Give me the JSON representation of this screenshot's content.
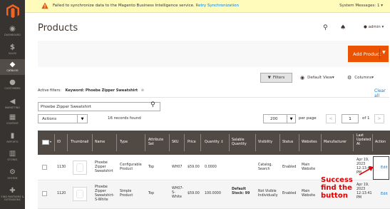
{
  "sidebar": {
    "items": [
      {
        "label": "DASHBOARD",
        "icon": "speedometer-icon"
      },
      {
        "label": "SALES",
        "icon": "dollar-icon"
      },
      {
        "label": "CATALOG",
        "icon": "cube-icon"
      },
      {
        "label": "CUSTOMERS",
        "icon": "person-icon"
      },
      {
        "label": "MARKETING",
        "icon": "megaphone-icon"
      },
      {
        "label": "CONTENT",
        "icon": "layout-icon"
      },
      {
        "label": "REPORTS",
        "icon": "bar-chart-icon"
      },
      {
        "label": "STORES",
        "icon": "store-icon"
      },
      {
        "label": "SYSTEM",
        "icon": "gear-icon"
      },
      {
        "label": "FIND PARTNERS & EXTENSIONS",
        "icon": "puzzle-icon"
      }
    ],
    "active": "CATALOG"
  },
  "banner": {
    "message": "Failed to synchronize data to the Magento Business Intelligence service.",
    "link": "Retry Synchronization",
    "system_messages": "System Messages: 1"
  },
  "header": {
    "title": "Products",
    "user": "admin"
  },
  "actions": {
    "add_product": "Add Product",
    "filters": "Filters",
    "view": "Default View",
    "columns": "Columns"
  },
  "filters": {
    "label": "Active filters:",
    "keyword": "Keyword: Phoebe Zipper Sweatshirt",
    "clear_all": "Clear all"
  },
  "search": {
    "value": "Phoebe Zipper Sweatshirt"
  },
  "toolbar": {
    "actions_label": "Actions",
    "records": "16 records found",
    "per_page_value": "200",
    "per_page_label": "per page",
    "page": "1",
    "of_pages": "of 1"
  },
  "table": {
    "headers": {
      "id": "ID",
      "thumbnail": "Thumbnail",
      "name": "Name",
      "type": "Type",
      "attribute_set": "Attribute Set",
      "sku": "SKU",
      "price": "Price",
      "quantity": "Quantity",
      "salable": "Salable Quantity",
      "visibility": "Visibility",
      "status": "Status",
      "websites": "Websites",
      "manufacturer": "Manufacturer",
      "updated": "Last Updated At",
      "action": "Action"
    },
    "rows": [
      {
        "id": "1130",
        "name": "Phoebe Zipper Sweatshirt",
        "type": "Configurable Product",
        "attribute_set": "Top",
        "sku": "WH07",
        "price": "$59.00",
        "quantity": "0.0000",
        "salable": "",
        "visibility": "Catalog, Search",
        "status": "Enabled",
        "websites": "Main Website",
        "manufacturer": "",
        "updated": "Apr 19, 2023 12:13:41 PM",
        "action": "Edit"
      },
      {
        "id": "1120",
        "name": "Phoebe Zipper Sweatshirt-S-White",
        "type": "Simple Product",
        "attribute_set": "Top",
        "sku": "WH07-S-White",
        "price": "$59.00",
        "quantity": "100.0000",
        "salable": "Default Stock: 99",
        "visibility": "Not Visible Individually",
        "status": "Enabled",
        "websites": "Main Website",
        "manufacturer": "",
        "updated": "Apr 19, 2023 12:13:41 PM",
        "action": "Edit"
      }
    ]
  },
  "annotation": "Success find the button",
  "colors": {
    "accent": "#eb5202",
    "sidebar": "#373330",
    "header": "#514943",
    "highlight": "#e00000"
  }
}
